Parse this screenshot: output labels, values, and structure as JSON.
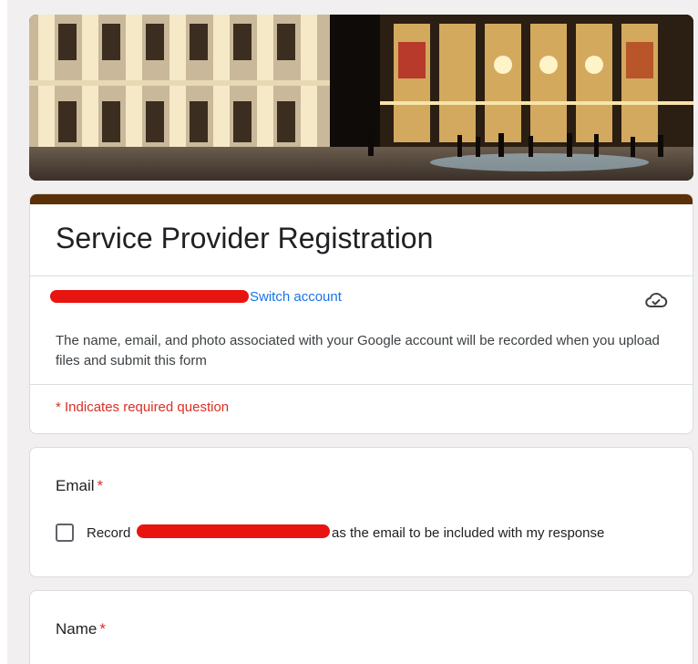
{
  "form": {
    "title": "Service Provider Registration",
    "switch_account_label": "Switch account",
    "notice": "The name, email, and photo associated with your Google account will be recorded when you upload files and submit this form",
    "required_note": "* Indicates required question"
  },
  "questions": [
    {
      "label": "Email",
      "required_marker": "*",
      "checkbox_prefix": "Record",
      "checkbox_suffix": "as the email to be included with my response",
      "checked": false
    },
    {
      "label": "Name",
      "required_marker": "*"
    }
  ],
  "colors": {
    "accent_bar": "#5b2f08",
    "link": "#1a73e8",
    "required": "#d93025",
    "redaction": "#e8140f"
  },
  "icons": {
    "save_status": "cloud-check-icon"
  }
}
